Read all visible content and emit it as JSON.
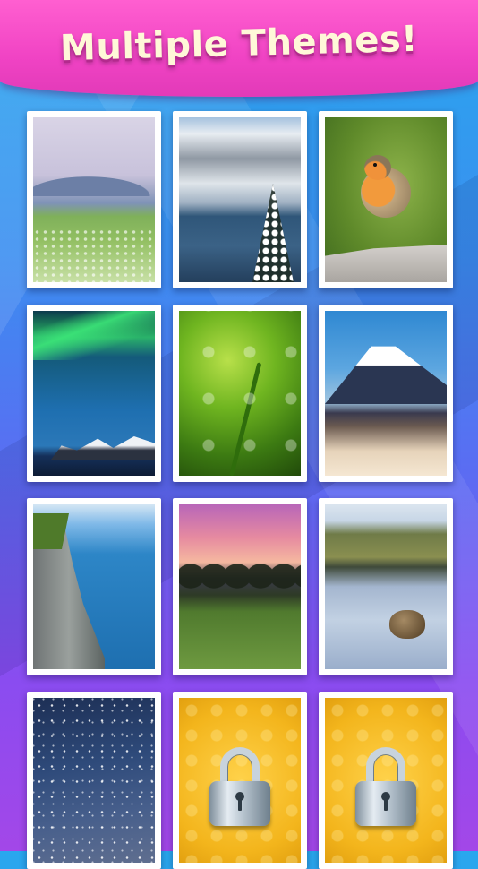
{
  "header": {
    "title": "Multiple Themes!"
  },
  "themes": [
    {
      "name": "meadow",
      "locked": false
    },
    {
      "name": "snowy-lake",
      "locked": false
    },
    {
      "name": "robin",
      "locked": false
    },
    {
      "name": "aurora",
      "locked": false
    },
    {
      "name": "grass-dew",
      "locked": false
    },
    {
      "name": "mount-fuji",
      "locked": false
    },
    {
      "name": "cliff",
      "locked": false
    },
    {
      "name": "sunset-field",
      "locked": false
    },
    {
      "name": "pond-reflection",
      "locked": false
    },
    {
      "name": "galaxy",
      "locked": false
    },
    {
      "name": "locked-theme",
      "locked": true,
      "icon": "padlock-icon"
    },
    {
      "name": "locked-theme",
      "locked": true,
      "icon": "padlock-icon"
    }
  ],
  "colors": {
    "header_pink": "#f043c4",
    "title_cream": "#fff8d8",
    "lock_gold": "#f3b51c"
  }
}
